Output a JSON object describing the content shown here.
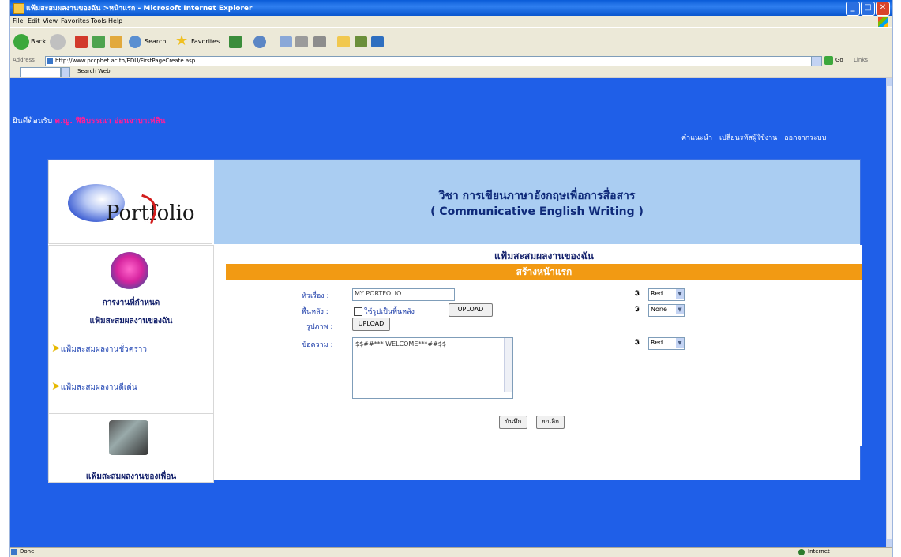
{
  "window": {
    "title": "แฟ้มสะสมผลงานของฉัน >หน้าแรก - Microsoft Internet Explorer",
    "min": "_",
    "max": "□",
    "close": "✕"
  },
  "menubar": {
    "items": [
      "File",
      "Edit",
      "View",
      "Favorites",
      "Tools",
      "Help"
    ]
  },
  "toolbar": {
    "back_label": "Back",
    "search_label": "Search",
    "favorites_label": "Favorites"
  },
  "address": {
    "label": "Address",
    "url": "http://www.pccphet.ac.th/EDU/FirstPageCreate.asp",
    "go_label": "Go",
    "links_label": "Links"
  },
  "search_toolbar": {
    "search_web_label": "Search Web"
  },
  "page": {
    "welcome_prefix": "ยินดีต้อนรับ",
    "welcome_name": "ด.ญ. ฟิลิบรรณา อ่อนจาบาเห่ลิน",
    "top_links": [
      "คำแนะนำ",
      "เปลี่ยนรหัสผู้ใช้งาน",
      "ออกจากระบบ"
    ],
    "logo_text": "Portfolio",
    "course_thai": "วิชา การเขียนภาษาอังกฤษเพื่อการสื่อสาร",
    "course_eng": "( Communicative English Writing )",
    "menu": {
      "assignments": "การงานที่กำหนด",
      "my_portfolio": "แฟ้มสะสมผลงานของฉัน",
      "sub_temp": "แฟ้มสะสมผลงานชั่วคราว",
      "sub_showcase": "แฟ้มสะสมผลงานดีเด่น",
      "friends_portfolio": "แฟ้มสะสมผลงานของเพื่อน"
    },
    "content": {
      "title": "แฟ้มสะสมผลงานของฉัน",
      "section": "สร้างหน้าแรก",
      "subject_label": "หัวเรื่อง :",
      "subject_value": "MY PORTFOLIO",
      "background_label": "พื้นหลัง :",
      "use_bg_image_label": "ใช้รูปเป็นพื้นหลัง",
      "upload_label": "UPLOAD",
      "image_label": "รูปภาพ :",
      "message_label": "ข้อความ :",
      "message_value": "$$##*** WELCOME***##$$",
      "color_icon": "𝕴",
      "subject_color": "Red",
      "background_color": "None",
      "message_color": "Red",
      "save_label": "บันทึก",
      "cancel_label": "ยกเลิก"
    }
  },
  "statusbar": {
    "status": "Done",
    "zone": "Internet"
  }
}
